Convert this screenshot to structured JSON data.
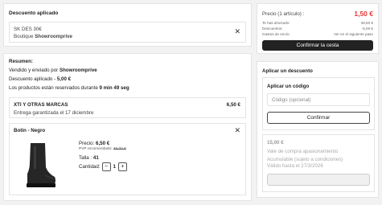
{
  "discount_applied": {
    "title": "Descuento aplicado",
    "code": "SK DES 30€",
    "store_prefix": "Boutique",
    "store_name": "Showroomprive"
  },
  "summary": {
    "title": "Resumen:",
    "sold_prefix": "Vendido y enviado por",
    "sold_by": "Showroomprive",
    "discount_label": "Descuento aplicado -",
    "discount_value": "5,00 €",
    "reserve_prefix": "Los productos están reservados durante",
    "reserve_time": "9 min 49 seg"
  },
  "shipment": {
    "brand": "XTI Y OTRAS MARCAS",
    "amount": "6,50 €",
    "delivery": "Entrega garantizada el 17 diciembre"
  },
  "product": {
    "name": "Botin - Negro",
    "price_label": "Precio:",
    "price": "6,50 €",
    "pvp_label": "PVP recomendado:",
    "pvp": "49,00 €",
    "size_label": "Talla :",
    "size": "41",
    "qty_label": "Cantidad:",
    "qty": "1",
    "minus": "−",
    "plus": "+"
  },
  "order_summary": {
    "price_label": "Precio (1 artículo) :",
    "price": "1,50 €",
    "saved_label": "Te has ahorrado:",
    "saved": "38,50 €",
    "discounts_label": "Descuentos:",
    "discounts": "-5,00 €",
    "shipping_label": "Gastos de envío:",
    "shipping": "Ver en el siguiente paso",
    "confirm_button": "Confirmar la cesta",
    "accent_color": "#e53935"
  },
  "apply_discount": {
    "title": "Aplicar un descuento",
    "code_title": "Aplicar un código",
    "code_placeholder": "Código (opcional)",
    "confirm_button": "Confirmar"
  },
  "voucher": {
    "amount": "15,00 €",
    "description": "Vale de compra apasionamiento",
    "accumulable": "Acumulable (sujeto a condiciones)",
    "valid_until": "Válido hasta el 27/3/2026"
  }
}
